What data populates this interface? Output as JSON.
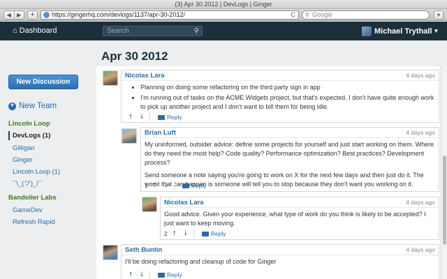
{
  "browser": {
    "window_title": "(3) Apr 30 2012 | DevLogs | Ginger",
    "url": "https://gingerhq.com/devlogs/1137/apr-30-2012/",
    "search_placeholder": "Google",
    "back": "◀",
    "forward": "▶",
    "new_tab": "+",
    "reload": "C"
  },
  "header": {
    "dashboard_label": "Dashboard",
    "search_placeholder": "Search",
    "user_name": "Michael Trythall"
  },
  "page": {
    "title": "Apr 30 2012"
  },
  "sidebar": {
    "new_discussion": "New Discussion",
    "new_team": "New Team",
    "groups": [
      {
        "name": "Lincoln Loop",
        "items": [
          "DevLogs (1)",
          "Gilligan",
          "Ginger",
          "Lincoln Loop (1)",
          "¯\\_(ツ)_/¯"
        ]
      },
      {
        "name": "Bandolier Labs",
        "items": [
          "GameDev",
          "Refresh Rapid"
        ]
      }
    ],
    "active_item": "DevLogs (1)"
  },
  "posts": [
    {
      "author": "Nicolas Lara",
      "time": "4 days ago",
      "bullets": [
        "Planning on doing some refactoring on the third party sign in app",
        "I'm running out of tasks on the ACME Widgets project, but that's expected. I don't have quite enough work to pick up another project and I don't want to bill them for being idle."
      ],
      "votes": "",
      "reply": "Reply"
    },
    {
      "author": "Brian Luft",
      "time": "4 days ago",
      "paragraphs": [
        "My uninformed, outsider advice: define some projects for yourself and just start working on them. Where do they need the most help? Code quality? Performance optimization? Best practices? Development process?",
        "Send someone a note saying you're going to work on X for the next few days and then just do it. The worst that can happen is someone will tell you to stop because they don't want you working on it."
      ],
      "votes": "1",
      "reply": "Reply"
    },
    {
      "author": "Nicolas Lara",
      "time": "4 days ago",
      "paragraphs": [
        "Good advice. Given your experience, what type of work do you think is likely to be accepted? I just want to keep moving."
      ],
      "votes": "2",
      "reply": "Reply"
    },
    {
      "author": "Seth Buntin",
      "time": "4 days ago",
      "paragraphs": [
        "I'll be doing refactoring and cleanup of code for Ginger"
      ],
      "votes": "",
      "reply": "Reply"
    }
  ]
}
